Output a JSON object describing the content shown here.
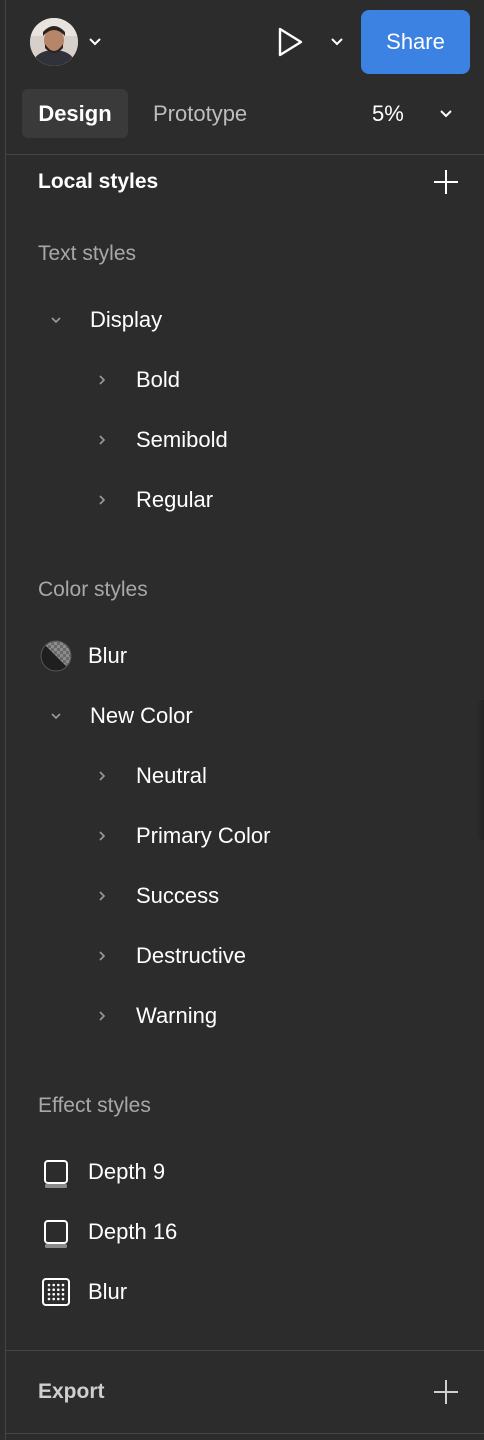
{
  "toolbar": {
    "share_label": "Share",
    "tabs": [
      {
        "label": "Design"
      },
      {
        "label": "Prototype"
      }
    ],
    "zoom": "5%"
  },
  "local_styles": {
    "title": "Local styles",
    "text_styles": {
      "label": "Text styles",
      "group": "Display",
      "items": [
        "Bold",
        "Semibold",
        "Regular"
      ]
    },
    "color_styles": {
      "label": "Color styles",
      "blur_label": "Blur",
      "group": "New Color",
      "items": [
        "Neutral",
        "Primary Color",
        "Success",
        "Destructive",
        "Warning"
      ]
    },
    "effect_styles": {
      "label": "Effect styles",
      "items": [
        "Depth 9",
        "Depth 16",
        "Blur"
      ]
    }
  },
  "export": {
    "title": "Export"
  },
  "colors": {
    "panel_bg": "#2c2c2c",
    "accent": "#3b82e2",
    "muted_text": "#a8a8a8"
  },
  "icons": [
    "chevron-down-icon",
    "play-icon",
    "plus-icon",
    "chevron-right-icon",
    "color-swatch-icon",
    "drop-shadow-icon",
    "blur-effect-icon"
  ]
}
